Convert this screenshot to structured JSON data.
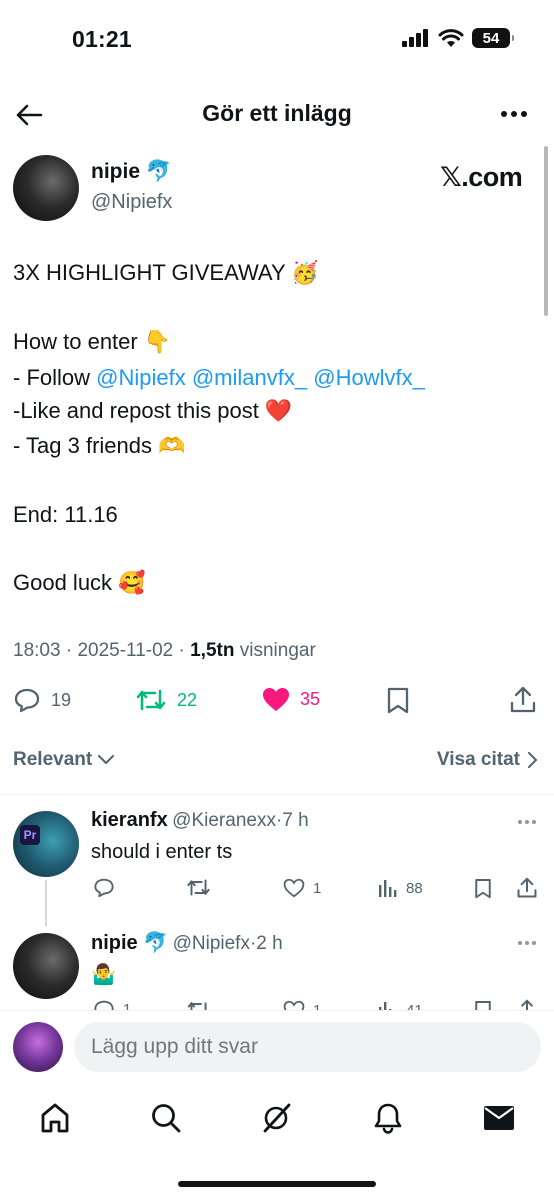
{
  "status_bar": {
    "time": "01:21",
    "battery": "54"
  },
  "header": {
    "title": "Gör ett inlägg"
  },
  "post": {
    "author_name": "nipie 🐬",
    "author_handle": "@Nipiefx",
    "source_badge": "𝕏.com",
    "lines": {
      "l1": "3X HIGHLIGHT GIVEAWAY 🥳",
      "l2": "How to enter 👇",
      "l3_prefix": "- Follow ",
      "mention1": "@Nipiefx",
      "mention2": "@milanvfx_",
      "mention3": "@Howlvfx_",
      "l4": "-Like and repost this post ❤️",
      "l5": "- Tag 3 friends 🫶",
      "l6": "End: 11.16",
      "l7": "Good luck 🥰"
    },
    "time": "18:03",
    "date": "2025-11-02",
    "views_count": "1,5tn",
    "views_label": "visningar",
    "replies": "19",
    "reposts": "22",
    "likes": "35"
  },
  "colors": {
    "accent": "#1d9bf0",
    "repost": "#00ba7c",
    "like": "#f91880",
    "secondary_text": "#536471"
  },
  "sort": {
    "label": "Relevant",
    "quotes_label": "Visa citat"
  },
  "replies": [
    {
      "name": "kieranfx",
      "handle": "@Kieranexx",
      "age": "7 h",
      "text": "should i enter ts",
      "reply_count": "",
      "repost_count": "",
      "like_count": "1",
      "views": "88"
    },
    {
      "name": "nipie 🐬",
      "handle": "@Nipiefx",
      "age": "2 h",
      "text": "🤷‍♂️",
      "reply_count": "1",
      "repost_count": "",
      "like_count": "1",
      "views": "41"
    }
  ],
  "compose": {
    "placeholder": "Lägg upp ditt svar"
  },
  "tabs": [
    "home-icon",
    "search-icon",
    "grok-icon",
    "bell-icon",
    "mail-icon"
  ]
}
